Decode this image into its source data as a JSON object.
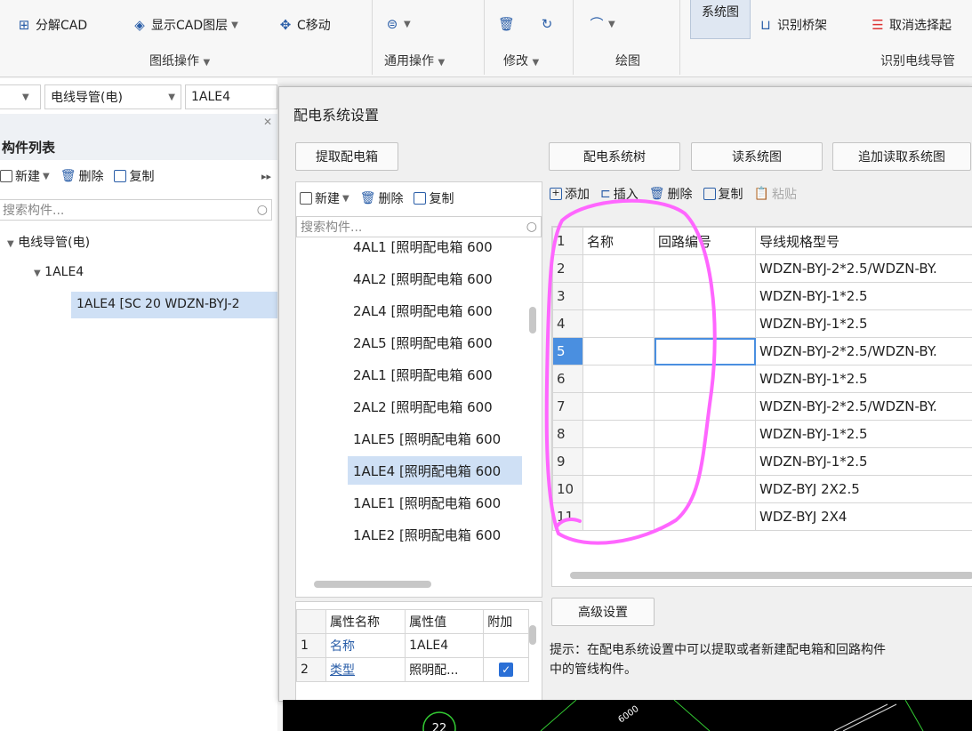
{
  "ribbon": {
    "items": {
      "split_cad": "分解CAD",
      "show_cad_layer": "显示CAD图层",
      "c_move": "C移动",
      "system_diagram": "系统图",
      "identify_bridge": "识别桥架",
      "cancel_select": "取消选择起"
    },
    "groups": {
      "drawing_ops": "图纸操作",
      "general_ops": "通用操作",
      "modify": "修改",
      "draw": "绘图",
      "identify_wire": "识别电线导管"
    }
  },
  "left_panel": {
    "combo_type": "电线导管(电)",
    "combo_item": "1ALE4",
    "component_list_title": "构件列表",
    "toolbar": {
      "new": "新建",
      "delete": "删除",
      "copy": "复制"
    },
    "search_placeholder": "搜索构件...",
    "tree": {
      "root": "电线导管(电)",
      "child": "1ALE4",
      "leaf": "1ALE4 [SC 20 WDZN-BYJ-2"
    }
  },
  "dialog": {
    "title": "配电系统设置",
    "extract_box_button": "提取配电箱",
    "tree_button": "配电系统树",
    "read_button": "读系统图",
    "append_read_button": "追加读取系统图",
    "left_toolbar": {
      "new": "新建",
      "delete": "删除",
      "copy": "复制"
    },
    "search_placeholder": "搜索构件...",
    "box_list": [
      "4AL1 [照明配电箱 600",
      "4AL2 [照明配电箱 600",
      "2AL4 [照明配电箱 600",
      "2AL5 [照明配电箱 600",
      "2AL1 [照明配电箱 600",
      "2AL2 [照明配电箱 600",
      "1ALE5 [照明配电箱 600",
      "1ALE4 [照明配电箱 600",
      "1ALE1 [照明配电箱 600",
      "1ALE2 [照明配电箱 600"
    ],
    "box_list_selected": "1ALE4 [照明配电箱 600",
    "right_toolbar": {
      "add": "添加",
      "insert": "插入",
      "delete": "删除",
      "copy": "复制",
      "paste": "粘贴"
    },
    "table_headers": {
      "row": "1",
      "name": "名称",
      "circuit": "回路编号",
      "wire": "导线规格型号"
    },
    "table_rows": [
      {
        "no": "2",
        "wire": "WDZN-BYJ-2*2.5/WDZN-BY."
      },
      {
        "no": "3",
        "wire": "WDZN-BYJ-1*2.5"
      },
      {
        "no": "4",
        "wire": "WDZN-BYJ-1*2.5"
      },
      {
        "no": "5",
        "wire": "WDZN-BYJ-2*2.5/WDZN-BY."
      },
      {
        "no": "6",
        "wire": "WDZN-BYJ-1*2.5"
      },
      {
        "no": "7",
        "wire": "WDZN-BYJ-2*2.5/WDZN-BY."
      },
      {
        "no": "8",
        "wire": "WDZN-BYJ-1*2.5"
      },
      {
        "no": "9",
        "wire": "WDZN-BYJ-1*2.5"
      },
      {
        "no": "10",
        "wire": "WDZ-BYJ 2X2.5"
      },
      {
        "no": "11",
        "wire": "WDZ-BYJ 2X4"
      }
    ],
    "prop_headers": {
      "name": "属性名称",
      "value": "属性值",
      "extra": "附加"
    },
    "prop_rows": [
      {
        "no": "1",
        "name": "名称",
        "value": "1ALE4",
        "checked": false
      },
      {
        "no": "2",
        "name": "类型",
        "value": "照明配...",
        "checked": true
      }
    ],
    "advanced_button": "高级设置",
    "hint_line1": "提示：在配电系统设置中可以提取或者新建配电箱和回路构件",
    "hint_line2": "中的管线构件。"
  },
  "cad": {
    "circle_label": "22",
    "dim_label": "6000"
  },
  "colors": {
    "selection": "#cfe0f5",
    "accent": "#2a5ea8",
    "annotation": "#ff66ff"
  }
}
